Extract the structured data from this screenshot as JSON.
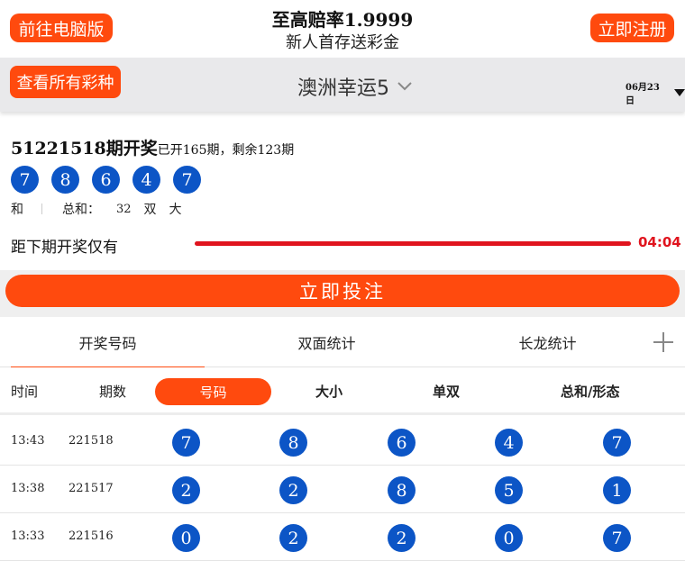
{
  "header": {
    "pc_button": "前往电脑版",
    "promo_line1": "至高赔率1.9999",
    "promo_line2": "新人首存送彩金",
    "register_button": "立即注册"
  },
  "lottery_bar": {
    "all_button": "查看所有彩种",
    "game_name": "澳洲幸运5",
    "date": "06月23日"
  },
  "draw": {
    "period": "51221518期开奖",
    "status": "已开165期，剩余123期",
    "numbers": [
      "7",
      "8",
      "6",
      "4",
      "7"
    ],
    "he_label": "和",
    "sum_label": "总和：",
    "sum_value": "32",
    "odd_even": "双",
    "big_small": "大",
    "countdown_label": "距下期开奖仅有",
    "countdown_progress": 1.0,
    "countdown_time": "04:04"
  },
  "bet_button": "立即投注",
  "tabs": [
    {
      "label": "开奖号码",
      "active": true
    },
    {
      "label": "双面统计",
      "active": false
    },
    {
      "label": "长龙统计",
      "active": false
    }
  ],
  "table": {
    "headers": [
      "时间",
      "期数",
      "号码",
      "大小",
      "单双",
      "总和/形态"
    ],
    "rows": [
      {
        "time": "13:43",
        "issue": "221518",
        "numbers": [
          "7",
          "8",
          "6",
          "4",
          "7"
        ]
      },
      {
        "time": "13:38",
        "issue": "221517",
        "numbers": [
          "2",
          "2",
          "8",
          "5",
          "1"
        ]
      },
      {
        "time": "13:33",
        "issue": "221516",
        "numbers": [
          "0",
          "2",
          "2",
          "0",
          "7"
        ]
      }
    ]
  },
  "colors": {
    "accent": "#ff4a0e",
    "ball": "#0c55c6",
    "countdown": "#e0141e"
  }
}
